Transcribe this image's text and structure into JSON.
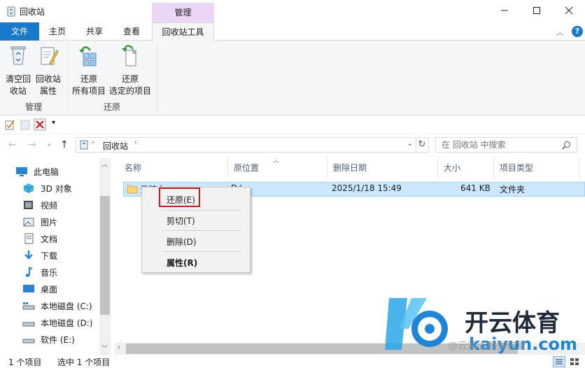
{
  "window": {
    "title": "回收站",
    "context_tab_group": "管理",
    "controls": {
      "minimize": "—",
      "maximize": "☐",
      "close": "✕"
    }
  },
  "ribbon_tabs": {
    "file": "文件",
    "home": "主页",
    "share": "共享",
    "view": "查看",
    "tools": "回收站工具"
  },
  "ribbon": {
    "empty_bin": "清空回\n收站",
    "bin_properties": "回收站\n属性",
    "restore_all": "还原\n所有项目",
    "restore_selected": "还原\n选定的项目",
    "group_manage": "管理",
    "group_restore": "还原"
  },
  "address": {
    "location": "回收站",
    "search_placeholder": "在 回收站 中搜索"
  },
  "nav_pane": {
    "items": [
      {
        "label": "此电脑",
        "icon": "computer-icon"
      },
      {
        "label": "3D 对象",
        "icon": "3d-objects-icon"
      },
      {
        "label": "视频",
        "icon": "video-icon"
      },
      {
        "label": "图片",
        "icon": "pictures-icon"
      },
      {
        "label": "文档",
        "icon": "documents-icon"
      },
      {
        "label": "下载",
        "icon": "download-icon"
      },
      {
        "label": "音乐",
        "icon": "music-icon"
      },
      {
        "label": "桌面",
        "icon": "desktop-icon"
      },
      {
        "label": "本地磁盘 (C:)",
        "icon": "drive-icon"
      },
      {
        "label": "本地磁盘 (D:)",
        "icon": "drive-icon"
      },
      {
        "label": "软件 (E:)",
        "icon": "drive-icon"
      }
    ]
  },
  "file_list": {
    "columns": [
      "名称",
      "原位置",
      "删除日期",
      "大小",
      "项目类型"
    ],
    "rows": [
      {
        "name": "云骑士",
        "original_location": "D:\\",
        "deleted": "2025/1/18 15:49",
        "size": "641 KB",
        "type": "文件夹"
      }
    ]
  },
  "context_menu": {
    "restore": "还原(E)",
    "cut": "剪切(T)",
    "delete": "删除(D)",
    "properties": "属性(R)"
  },
  "status_bar": {
    "item_count": "1 个项目",
    "selected": "选中 1 个项目"
  },
  "watermark": {
    "brand_cn": "开云体育",
    "brand_en": "kaiyun.com",
    "handle": "@云骑士数据恢复"
  },
  "colors": {
    "accent": "#1979ca",
    "context_tab": "#ead7f5",
    "selection": "#cce8ff",
    "highlight_box": "#d7191f"
  }
}
